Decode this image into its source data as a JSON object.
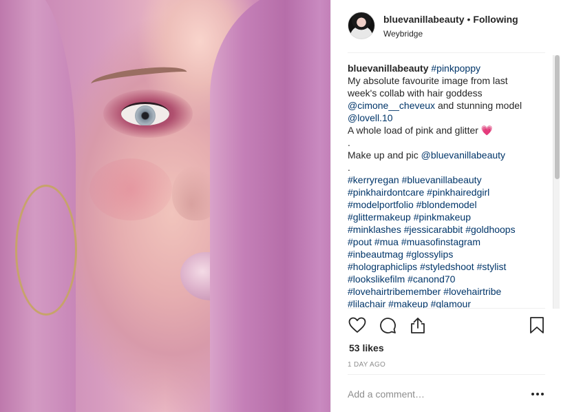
{
  "post": {
    "username": "bluevanillabeauty",
    "separator": "•",
    "follow_status": "Following",
    "location": "Weybridge",
    "caption_lines": [
      {
        "parts": [
          {
            "text": "bluevanillabeauty",
            "style": "uname"
          },
          {
            "text": " "
          },
          {
            "text": "#pinkpoppy",
            "style": "link"
          }
        ]
      },
      {
        "parts": [
          {
            "text": "My absolute favourite image from last"
          }
        ]
      },
      {
        "parts": [
          {
            "text": "week's collab with hair goddess"
          }
        ]
      },
      {
        "parts": [
          {
            "text": "@cimone__cheveux",
            "style": "link"
          },
          {
            "text": " and stunning model"
          }
        ]
      },
      {
        "parts": [
          {
            "text": "@lovell.10",
            "style": "link"
          }
        ]
      },
      {
        "parts": [
          {
            "text": "A whole load of pink and glitter 💗"
          }
        ]
      },
      {
        "parts": [
          {
            "text": "."
          }
        ]
      },
      {
        "parts": [
          {
            "text": "Make up and pic "
          },
          {
            "text": "@bluevanillabeauty",
            "style": "link"
          }
        ]
      },
      {
        "parts": [
          {
            "text": "."
          }
        ]
      },
      {
        "parts": [
          {
            "text": "#kerryregan #bluevanillabeauty",
            "style": "link"
          }
        ]
      },
      {
        "parts": [
          {
            "text": "#pinkhairdontcare #pinkhairedgirl",
            "style": "link"
          }
        ]
      },
      {
        "parts": [
          {
            "text": "#modelportfolio #blondemodel",
            "style": "link"
          }
        ]
      },
      {
        "parts": [
          {
            "text": "#glittermakeup #pinkmakeup",
            "style": "link"
          }
        ]
      },
      {
        "parts": [
          {
            "text": "#minklashes #jessicarabbit #goldhoops",
            "style": "link"
          }
        ]
      },
      {
        "parts": [
          {
            "text": "#pout #mua #muasofinstagram",
            "style": "link"
          }
        ]
      },
      {
        "parts": [
          {
            "text": "#inbeautmag #glossylips",
            "style": "link"
          }
        ]
      },
      {
        "parts": [
          {
            "text": "#holographiclips #styledshoot #stylist",
            "style": "link"
          }
        ]
      },
      {
        "parts": [
          {
            "text": "#lookslikefilm #canond70",
            "style": "link"
          }
        ]
      },
      {
        "parts": [
          {
            "text": "#lovehairtribemember #lovehairtribe",
            "style": "link"
          }
        ]
      },
      {
        "parts": [
          {
            "text": "#lilachair #makeup #glamour",
            "style": "link"
          }
        ]
      }
    ],
    "likes": "53 likes",
    "timestamp": "1 DAY AGO",
    "comment_placeholder": "Add a comment…",
    "icons": {
      "like": "heart-icon",
      "comment": "comment-bubble-icon",
      "share": "share-upload-icon",
      "save": "bookmark-icon",
      "more": "more-horizontal-icon"
    }
  },
  "colors": {
    "link": "#003569",
    "text": "#262626",
    "muted": "#8e8e8e",
    "divider": "#efefef"
  }
}
